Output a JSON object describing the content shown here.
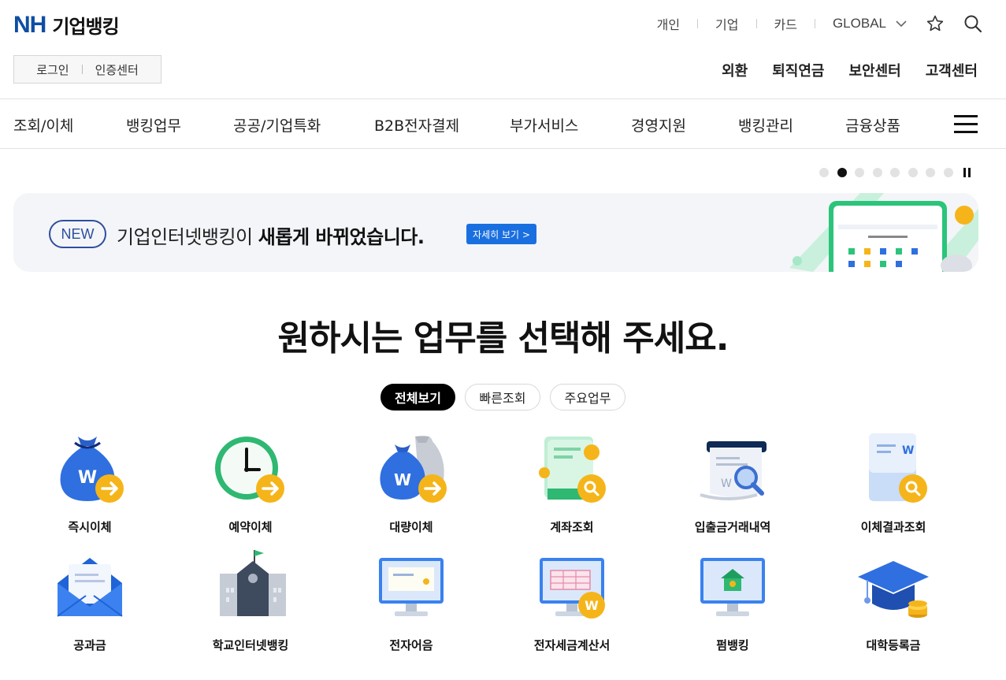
{
  "header": {
    "logo_nh": "NH",
    "logo_text": "기업뱅킹",
    "util_nav": [
      "개인",
      "기업",
      "카드"
    ],
    "global_label": "GLOBAL",
    "login_label": "로그인",
    "cert_label": "인증센터",
    "sub_nav": [
      "외환",
      "퇴직연금",
      "보안센터",
      "고객센터"
    ]
  },
  "gnb": {
    "items": [
      "조회/이체",
      "뱅킹업무",
      "공공/기업특화",
      "B2B전자결제",
      "부가서비스",
      "경영지원",
      "뱅킹관리",
      "금융상품"
    ]
  },
  "banner": {
    "new_label": "NEW",
    "message_normal": "기업인터넷뱅킹이 ",
    "message_bold": "새롭게 바뀌었습니다.",
    "detail_button": "자세히 보기 >",
    "slide_count": 8,
    "active_slide": 2
  },
  "section": {
    "title": "원하시는 업무를 선택해 주세요.",
    "tabs": [
      "전체보기",
      "빠른조회",
      "주요업무"
    ],
    "active_tab": 0
  },
  "services": [
    {
      "label": "즉시이체",
      "icon": "money-bag-arrow-icon"
    },
    {
      "label": "예약이체",
      "icon": "clock-arrow-icon"
    },
    {
      "label": "대량이체",
      "icon": "money-bags-arrow-icon"
    },
    {
      "label": "계좌조회",
      "icon": "bankbook-search-icon"
    },
    {
      "label": "입출금거래내역",
      "icon": "receipt-search-icon"
    },
    {
      "label": "이체결과조회",
      "icon": "document-search-icon"
    },
    {
      "label": "공과금",
      "icon": "envelope-icon"
    },
    {
      "label": "학교인터넷뱅킹",
      "icon": "school-icon"
    },
    {
      "label": "전자어음",
      "icon": "monitor-bill-icon"
    },
    {
      "label": "전자세금계산서",
      "icon": "monitor-tax-invoice-icon"
    },
    {
      "label": "펌뱅킹",
      "icon": "monitor-bank-icon"
    },
    {
      "label": "대학등록금",
      "icon": "graduation-cap-icon"
    }
  ],
  "colors": {
    "brand_blue": "#0e4ea3",
    "button_blue": "#1a6fe0",
    "accent_yellow": "#f5b51a",
    "icon_blue": "#2f6fe0",
    "icon_green": "#2eb872"
  }
}
